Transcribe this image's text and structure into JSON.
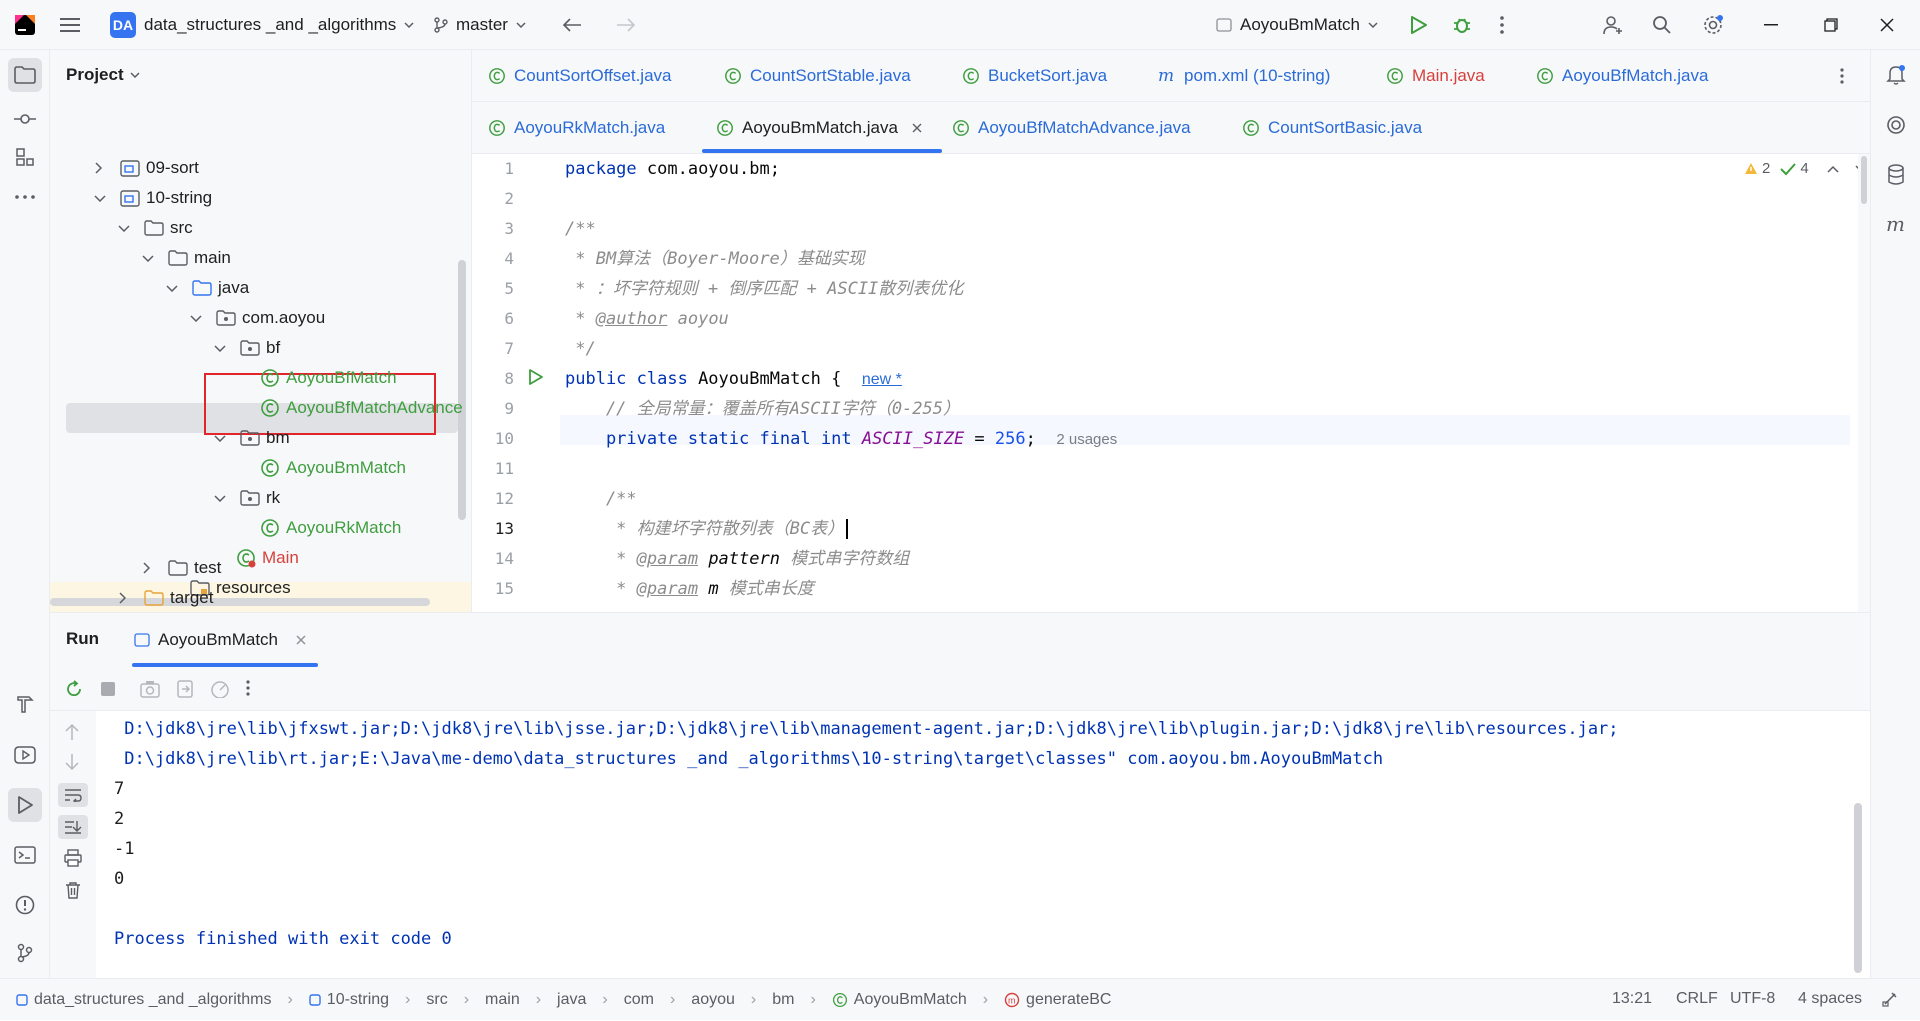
{
  "titlebar": {
    "project_badge": "DA",
    "project_name": "data_structures _and _algorithms",
    "branch": "master",
    "run_config": "AoyouBmMatch",
    "colors": {
      "accent": "#3574f0",
      "run_green": "#3f9e3f"
    }
  },
  "project_panel": {
    "title": "Project",
    "tree": [
      {
        "label": "09-sort",
        "kind": "module",
        "expanded": false
      },
      {
        "label": "10-string",
        "kind": "module",
        "expanded": true
      },
      {
        "label": "src",
        "kind": "folder",
        "expanded": true
      },
      {
        "label": "main",
        "kind": "folder",
        "expanded": true
      },
      {
        "label": "java",
        "kind": "source-folder",
        "expanded": true
      },
      {
        "label": "com.aoyou",
        "kind": "package",
        "expanded": true
      },
      {
        "label": "bf",
        "kind": "package",
        "expanded": true
      },
      {
        "label": "AoyouBfMatch",
        "kind": "class"
      },
      {
        "label": "AoyouBfMatchAdvance",
        "kind": "class"
      },
      {
        "label": "bm",
        "kind": "package",
        "expanded": true
      },
      {
        "label": "AoyouBmMatch",
        "kind": "class",
        "selected": true
      },
      {
        "label": "rk",
        "kind": "package",
        "expanded": true
      },
      {
        "label": "AoyouRkMatch",
        "kind": "class"
      },
      {
        "label": "Main",
        "kind": "class",
        "error": true
      },
      {
        "label": "resources",
        "kind": "folder"
      },
      {
        "label": "test",
        "kind": "folder",
        "expanded": false
      },
      {
        "label": "target",
        "kind": "excluded-folder",
        "expanded": false
      }
    ]
  },
  "tabs_row1": [
    {
      "label": "CountSortOffset.java",
      "icon": "class-icon"
    },
    {
      "label": "CountSortStable.java",
      "icon": "class-icon"
    },
    {
      "label": "BucketSort.java",
      "icon": "class-icon"
    },
    {
      "label": "pom.xml (10-string)",
      "icon": "maven-icon"
    },
    {
      "label": "Main.java",
      "icon": "class-icon",
      "error": true
    },
    {
      "label": "AoyouBfMatch.java",
      "icon": "class-icon"
    }
  ],
  "tabs_row2": [
    {
      "label": "AoyouRkMatch.java",
      "icon": "class-icon"
    },
    {
      "label": "AoyouBmMatch.java",
      "icon": "class-icon",
      "active": true
    },
    {
      "label": "AoyouBfMatchAdvance.java",
      "icon": "class-icon"
    },
    {
      "label": "CountSortBasic.java",
      "icon": "class-icon"
    }
  ],
  "editor": {
    "inspections": {
      "warnings": "2",
      "ok": "4"
    },
    "line_numbers": [
      "1",
      "2",
      "3",
      "4",
      "5",
      "6",
      "7",
      "8",
      "9",
      "10",
      "11",
      "12",
      "13",
      "14",
      "15"
    ],
    "lines": {
      "l1_kw": "package",
      "l1_rest": " com.aoyou.bm;",
      "l3": "/**",
      "l4": " * BM算法（Boyer-Moore）基础实现",
      "l5": " * ：坏字符规则 + 倒序匹配 + ASCII散列表优化",
      "l6_pre": " * ",
      "l6_tag": "@author",
      "l6_post": " aoyou",
      "l7": " */",
      "l8_kw": "public class",
      "l8_name": " AoyouBmMatch {",
      "l8_hint": "new *",
      "l9": "    // 全局常量：覆盖所有ASCII字符（0-255）",
      "l10_kw": "    private static final int",
      "l10_const": "ASCII_SIZE",
      "l10_eq": " = ",
      "l10_num": "256",
      "l10_semi": ";",
      "l10_hint": "2 usages",
      "l12": "    /**",
      "l13": "     * 构建坏字符散列表（BC表）",
      "l14_pre": "     * ",
      "l14_tag": "@param",
      "l14_p": " pattern",
      "l14_desc": " 模式串字符数组",
      "l15_pre": "     * ",
      "l15_tag": "@param",
      "l15_p": " m",
      "l15_desc": " 模式串长度"
    }
  },
  "run_panel": {
    "title": "Run",
    "tab_label": "AoyouBmMatch",
    "console": [
      " D:\\jdk8\\jre\\lib\\jfxswt.jar;D:\\jdk8\\jre\\lib\\jsse.jar;D:\\jdk8\\jre\\lib\\management-agent.jar;D:\\jdk8\\jre\\lib\\plugin.jar;D:\\jdk8\\jre\\lib\\resources.jar;",
      " D:\\jdk8\\jre\\lib\\rt.jar;E:\\Java\\me-demo\\data_structures _and _algorithms\\10-string\\target\\classes\" com.aoyou.bm.AoyouBmMatch",
      "7",
      "2",
      "-1",
      "0",
      "",
      "Process finished with exit code 0"
    ]
  },
  "statusbar": {
    "breadcrumbs": [
      "data_structures _and _algorithms",
      "10-string",
      "src",
      "main",
      "java",
      "com",
      "aoyou",
      "bm",
      "AoyouBmMatch",
      "generateBC"
    ],
    "position": "13:21",
    "line_sep": "CRLF",
    "encoding": "UTF-8",
    "indent": "4 spaces"
  }
}
